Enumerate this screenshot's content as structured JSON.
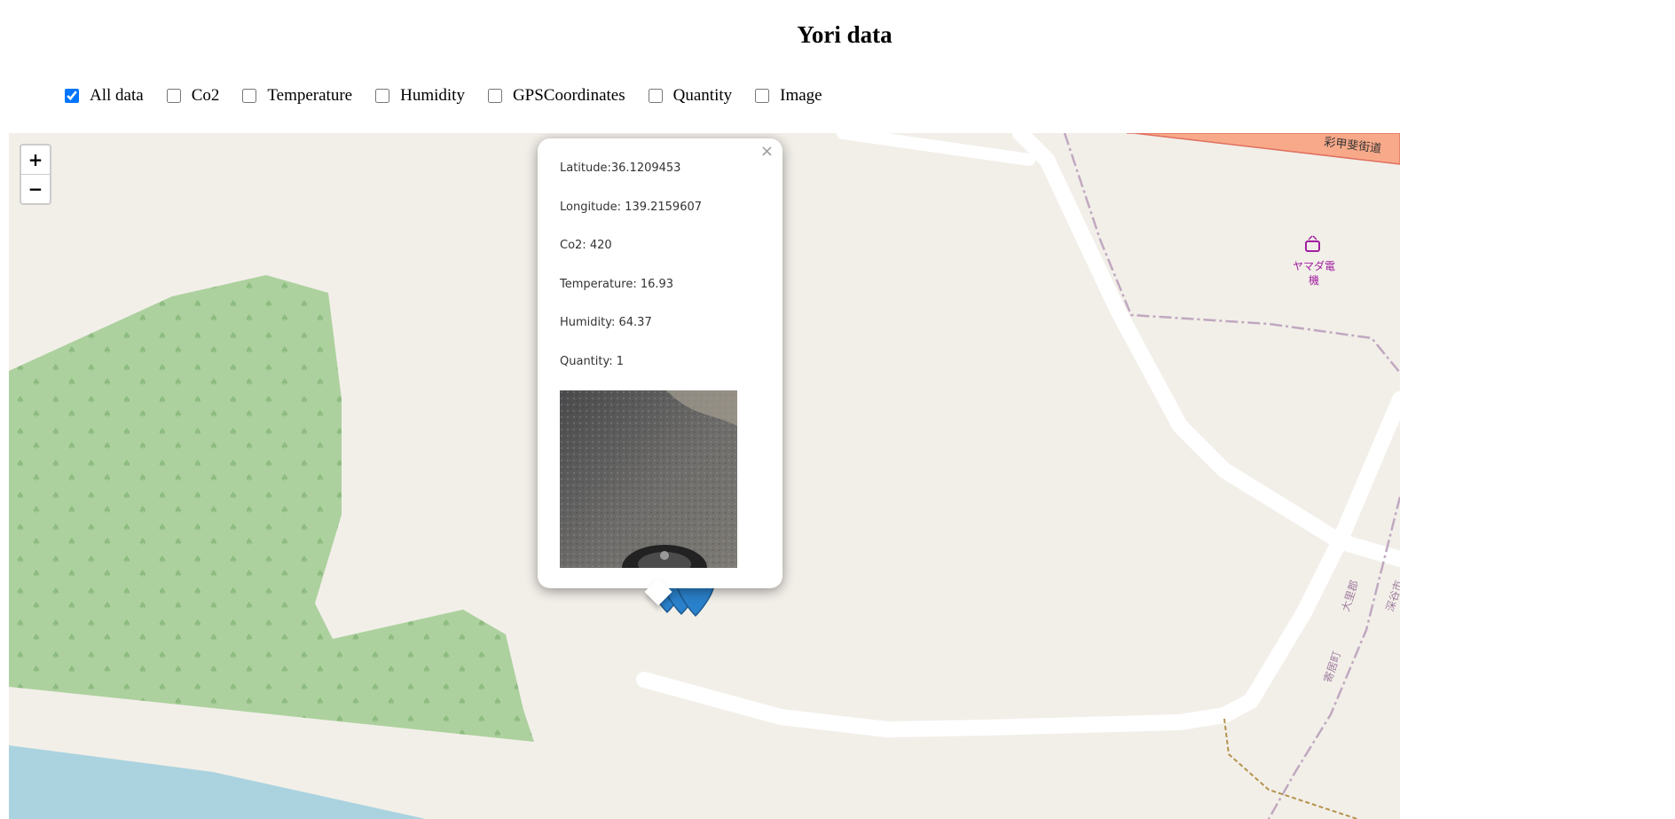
{
  "page": {
    "title": "Yori data"
  },
  "filters": [
    {
      "label": "All data",
      "checked": true
    },
    {
      "label": "Co2",
      "checked": false
    },
    {
      "label": "Temperature",
      "checked": false
    },
    {
      "label": "Humidity",
      "checked": false
    },
    {
      "label": "GPSCoordinates",
      "checked": false
    },
    {
      "label": "Quantity",
      "checked": false
    },
    {
      "label": "Image",
      "checked": false
    }
  ],
  "map": {
    "zoom_in_label": "+",
    "zoom_out_label": "−",
    "road_label": "彩甲斐街道",
    "poi_label_line1": "ヤマダ電",
    "poi_label_line2": "機",
    "boundary_label_1": "大里郡",
    "boundary_label_2": "寄居町",
    "boundary_label_3": "深谷市",
    "poi_icon": "tv-icon",
    "colors": {
      "forest": "#add19e",
      "water": "#aad3df",
      "road": "#ffffff",
      "land": "#f2efe9",
      "boundary": "#c0a8c0",
      "marker": "#2a81cb"
    }
  },
  "popup": {
    "close_label": "×",
    "latitude": "Latitude:36.1209453",
    "longitude": "Longitude: 139.2159607",
    "co2": "Co2: 420",
    "temperature": "Temperature: 16.93",
    "humidity": "Humidity: 64.37",
    "quantity": "Quantity: 1"
  }
}
